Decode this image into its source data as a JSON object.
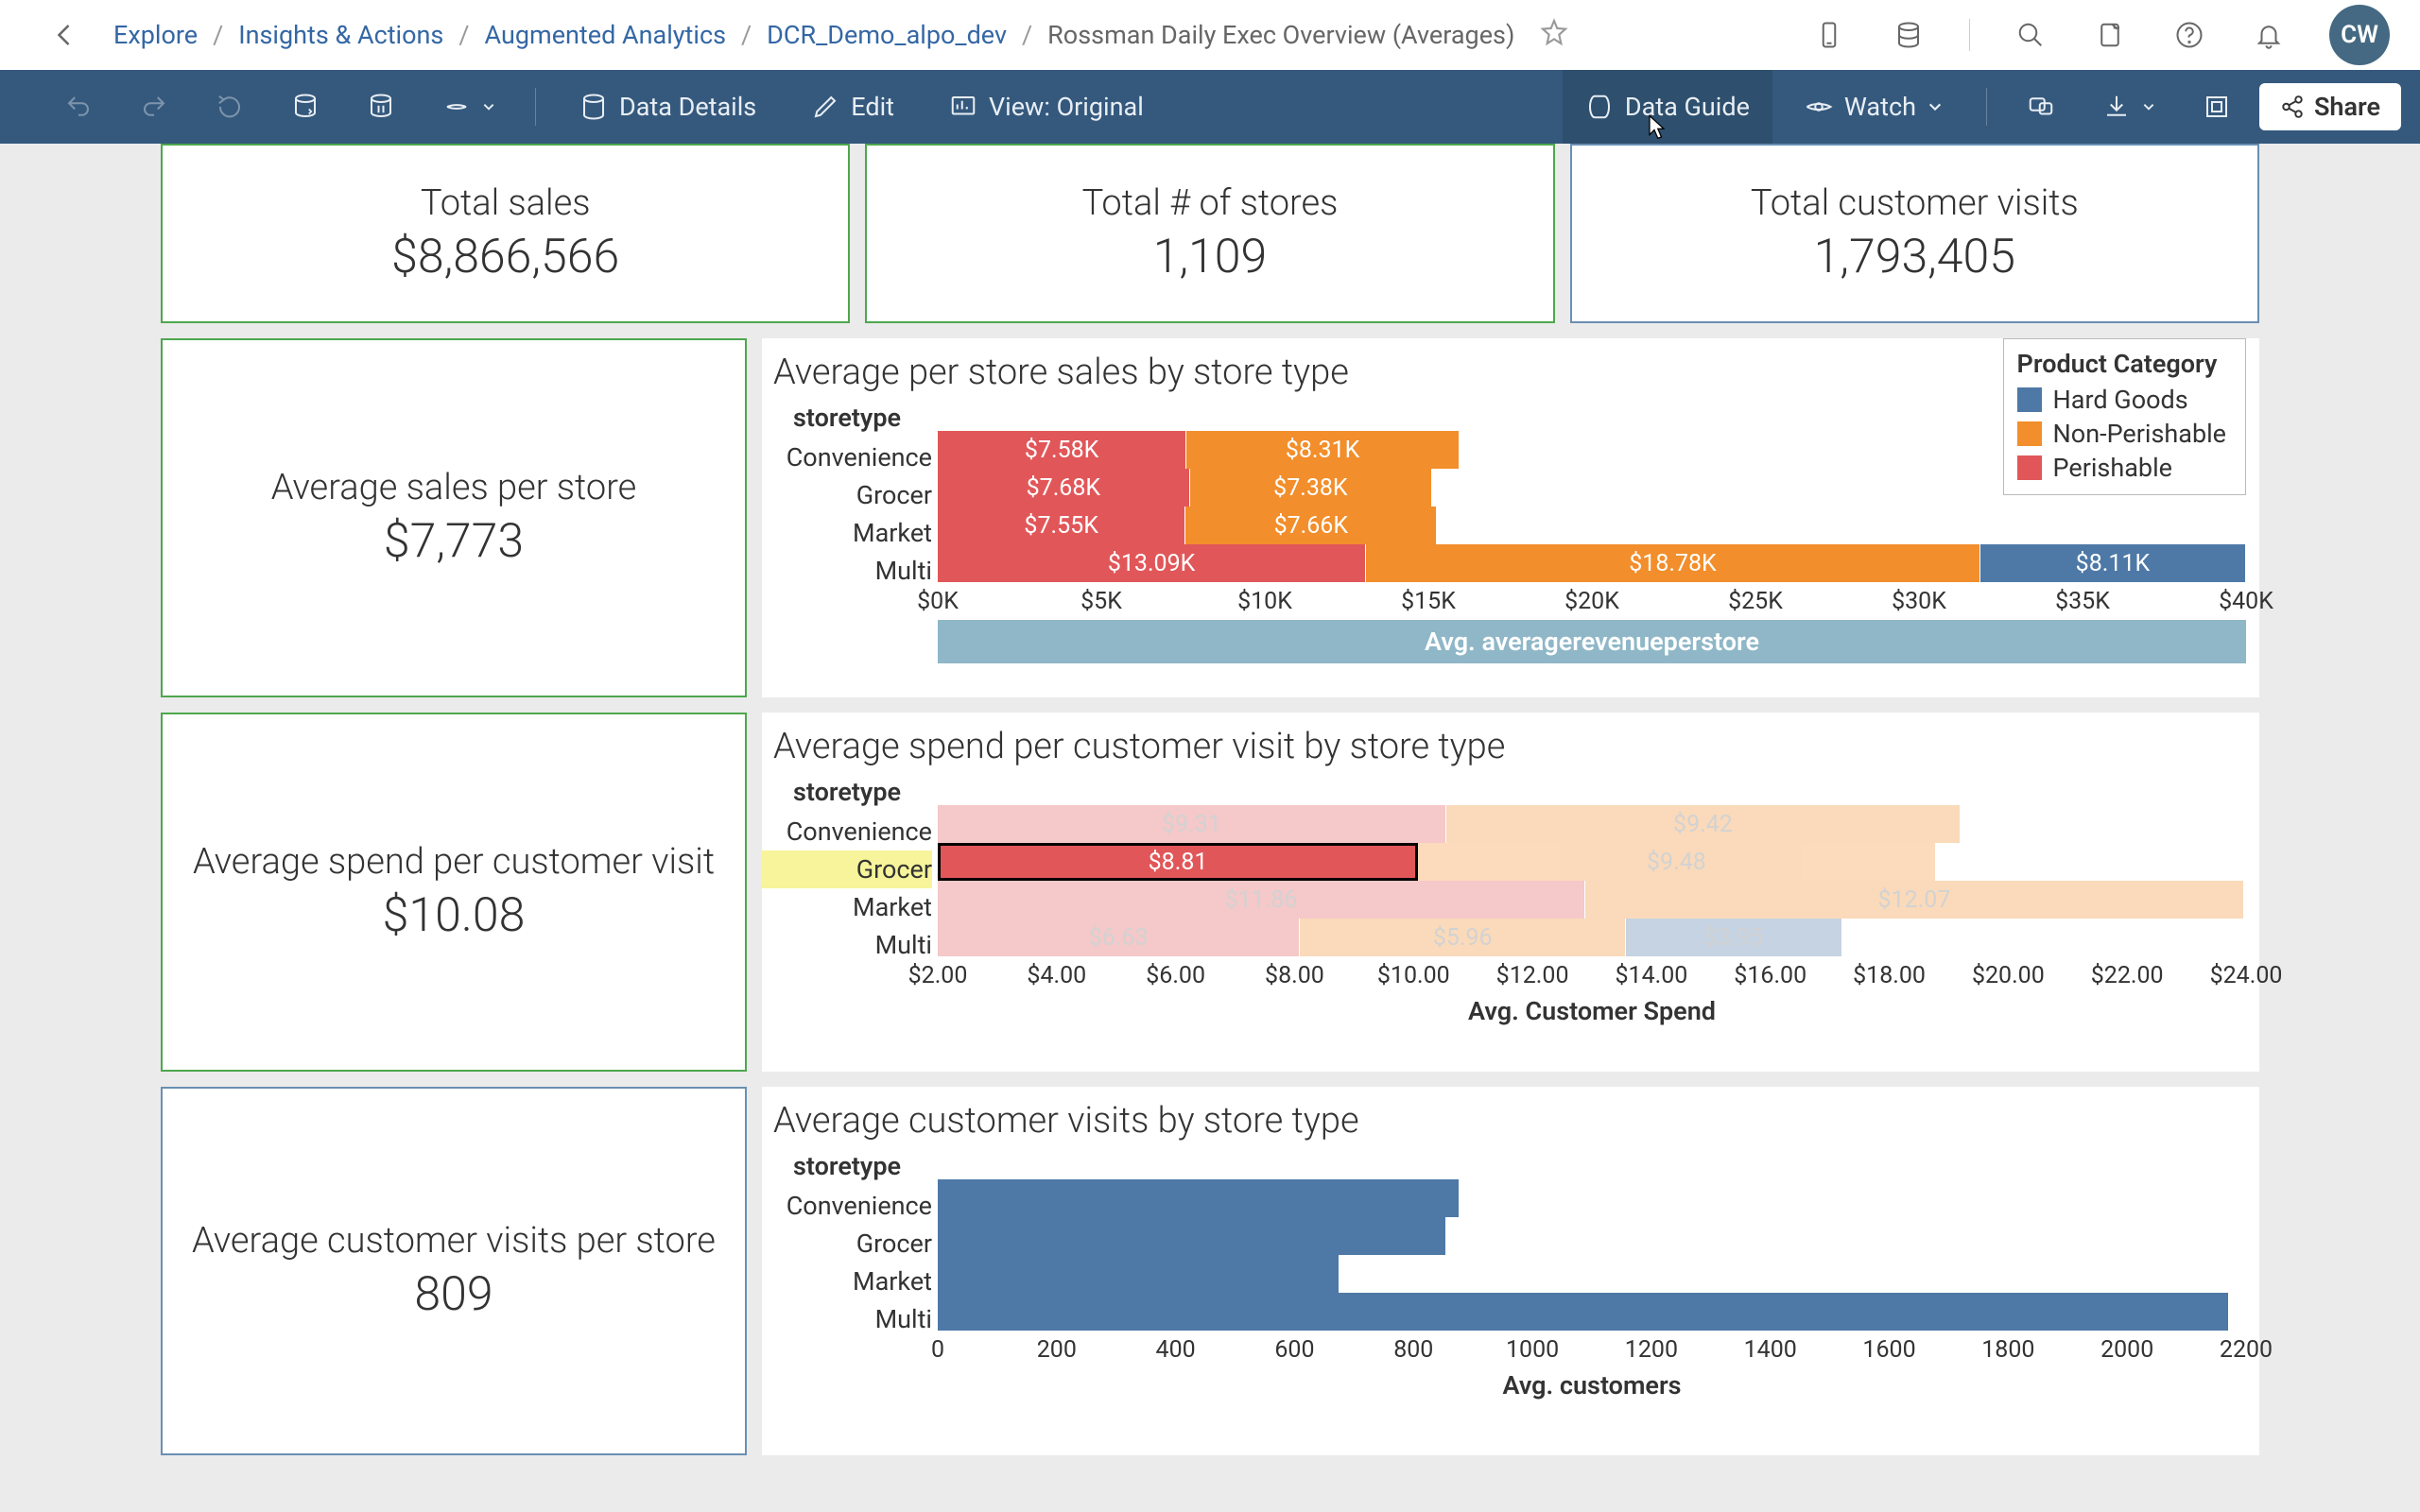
{
  "breadcrumb": {
    "items": [
      "Explore",
      "Insights & Actions",
      "Augmented Analytics",
      "DCR_Demo_alpo_dev"
    ],
    "current": "Rossman Daily Exec Overview (Averages)"
  },
  "avatar_initials": "CW",
  "toolbar": {
    "data_details": "Data Details",
    "edit": "Edit",
    "view": "View: Original",
    "data_guide": "Data Guide",
    "watch": "Watch",
    "share": "Share"
  },
  "kpis": {
    "total_sales": {
      "label": "Total sales",
      "value": "$8,866,566"
    },
    "total_stores": {
      "label": "Total # of stores",
      "value": "1,109"
    },
    "total_visits": {
      "label": "Total customer visits",
      "value": "1,793,405"
    },
    "avg_sales": {
      "label": "Average sales per store",
      "value": "$7,773"
    },
    "avg_spend": {
      "label": "Average spend per customer visit",
      "value": "$10.08"
    },
    "avg_visits": {
      "label": "Average customer visits per store",
      "value": "809"
    }
  },
  "legend": {
    "title": "Product Category",
    "items": [
      {
        "name": "Hard Goods",
        "color": "#4e79a7"
      },
      {
        "name": "Non-Perishable",
        "color": "#f28e2b"
      },
      {
        "name": "Perishable",
        "color": "#e15759"
      }
    ]
  },
  "charts": {
    "revenue": {
      "title": "Average per store sales by store type",
      "ylabel_head": "storetype",
      "axis_title": "Avg. averagerevenueperstore",
      "categories": [
        "Convenience",
        "Grocer",
        "Market",
        "Multi"
      ],
      "ticks": [
        "$0K",
        "$5K",
        "$10K",
        "$15K",
        "$20K",
        "$25K",
        "$30K",
        "$35K",
        "$40K"
      ],
      "segments": {
        "Convenience": [
          {
            "cat": "perish",
            "label": "$7.58K",
            "w": 18.95
          },
          {
            "cat": "nonperish",
            "label": "$8.31K",
            "w": 20.78
          }
        ],
        "Grocer": [
          {
            "cat": "perish",
            "label": "$7.68K",
            "w": 19.2
          },
          {
            "cat": "nonperish",
            "label": "$7.38K",
            "w": 18.45
          }
        ],
        "Market": [
          {
            "cat": "perish",
            "label": "$7.55K",
            "w": 18.88
          },
          {
            "cat": "nonperish",
            "label": "$7.66K",
            "w": 19.15
          }
        ],
        "Multi": [
          {
            "cat": "perish",
            "label": "$13.09K",
            "w": 32.73
          },
          {
            "cat": "nonperish",
            "label": "$18.78K",
            "w": 46.95
          },
          {
            "cat": "hard",
            "label": "$8.11K",
            "w": 20.28
          }
        ]
      }
    },
    "spend": {
      "title": "Average spend per customer visit by store type",
      "ylabel_head": "storetype",
      "axis_title": "Avg. Customer Spend",
      "categories": [
        "Convenience",
        "Grocer",
        "Market",
        "Multi"
      ],
      "ticks": [
        "$2.00",
        "$4.00",
        "$6.00",
        "$8.00",
        "$10.00",
        "$12.00",
        "$14.00",
        "$16.00",
        "$18.00",
        "$20.00",
        "$22.00",
        "$24.00"
      ],
      "highlight_row": "Grocer",
      "segments": {
        "Convenience": [
          {
            "cat": "perish",
            "label": "$9.31",
            "w": 38.79
          },
          {
            "cat": "nonperish",
            "label": "$9.42",
            "w": 39.25
          }
        ],
        "Grocer": [
          {
            "cat": "perish",
            "label": "$8.81",
            "w": 36.71,
            "selected": true
          },
          {
            "cat": "nonperish",
            "label": "$9.48",
            "w": 39.5
          }
        ],
        "Market": [
          {
            "cat": "perish",
            "label": "$11.86",
            "w": 49.42
          },
          {
            "cat": "nonperish",
            "label": "$12.07",
            "w": 50.29
          }
        ],
        "Multi": [
          {
            "cat": "perish",
            "label": "$6.63",
            "w": 27.63
          },
          {
            "cat": "nonperish",
            "label": "$5.96",
            "w": 24.83
          },
          {
            "cat": "hard",
            "label": "$3.95",
            "w": 16.46
          }
        ]
      }
    },
    "visits": {
      "title": "Average customer visits by store type",
      "ylabel_head": "storetype",
      "axis_title": "Avg. customers",
      "categories": [
        "Convenience",
        "Grocer",
        "Market",
        "Multi"
      ],
      "ticks": [
        "0",
        "200",
        "400",
        "600",
        "800",
        "1000",
        "1200",
        "1400",
        "1600",
        "1800",
        "2000",
        "2200"
      ],
      "bars": {
        "Convenience": 39.8,
        "Grocer": 38.8,
        "Market": 30.6,
        "Multi": 98.6
      }
    }
  },
  "chart_data": [
    {
      "type": "bar",
      "stacked": true,
      "title": "Average per store sales by store type",
      "ylabel": "storetype",
      "xlabel": "Avg. averagerevenueperstore",
      "xlim": [
        0,
        40
      ],
      "x_unit": "$K",
      "categories": [
        "Convenience",
        "Grocer",
        "Market",
        "Multi"
      ],
      "series": [
        {
          "name": "Perishable",
          "values": [
            7.58,
            7.68,
            7.55,
            13.09
          ]
        },
        {
          "name": "Non-Perishable",
          "values": [
            8.31,
            7.38,
            7.66,
            18.78
          ]
        },
        {
          "name": "Hard Goods",
          "values": [
            null,
            null,
            null,
            8.11
          ]
        }
      ]
    },
    {
      "type": "bar",
      "stacked": true,
      "title": "Average spend per customer visit by store type",
      "ylabel": "storetype",
      "xlabel": "Avg. Customer Spend",
      "xlim": [
        0,
        24
      ],
      "x_unit": "$",
      "categories": [
        "Convenience",
        "Grocer",
        "Market",
        "Multi"
      ],
      "highlighted": {
        "category": "Grocer",
        "series": "Perishable"
      },
      "series": [
        {
          "name": "Perishable",
          "values": [
            9.31,
            8.81,
            11.86,
            6.63
          ]
        },
        {
          "name": "Non-Perishable",
          "values": [
            9.42,
            9.48,
            12.07,
            5.96
          ]
        },
        {
          "name": "Hard Goods",
          "values": [
            null,
            null,
            null,
            3.95
          ]
        }
      ]
    },
    {
      "type": "bar",
      "stacked": false,
      "title": "Average customer visits by store type",
      "ylabel": "storetype",
      "xlabel": "Avg. customers",
      "xlim": [
        0,
        2200
      ],
      "categories": [
        "Convenience",
        "Grocer",
        "Market",
        "Multi"
      ],
      "values": [
        875,
        855,
        675,
        2170
      ]
    }
  ]
}
